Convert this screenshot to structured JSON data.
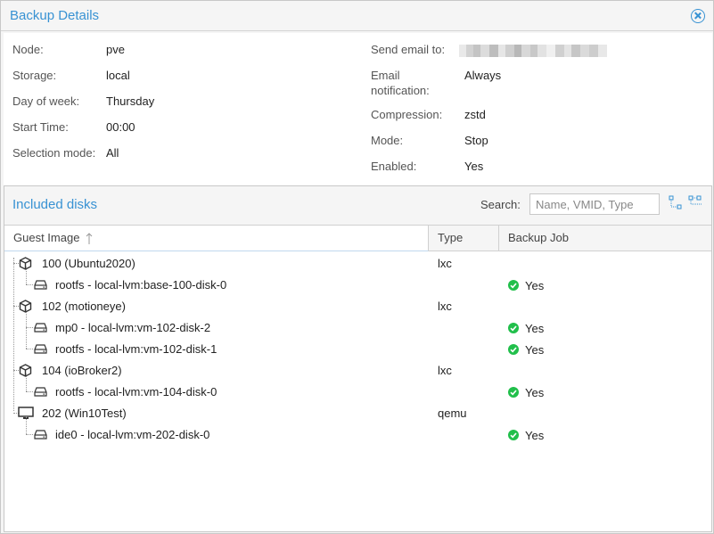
{
  "window": {
    "title": "Backup Details"
  },
  "details": {
    "left": [
      {
        "label": "Node:",
        "value": "pve"
      },
      {
        "label": "Storage:",
        "value": "local"
      },
      {
        "label": "Day of week:",
        "value": "Thursday"
      },
      {
        "label": "Start Time:",
        "value": "00:00"
      },
      {
        "label": "Selection mode:",
        "value": "All"
      }
    ],
    "right": [
      {
        "label": "Send email to:",
        "value": ""
      },
      {
        "label": "Email notification:",
        "value": "Always"
      },
      {
        "label": "Compression:",
        "value": "zstd"
      },
      {
        "label": "Mode:",
        "value": "Stop"
      },
      {
        "label": "Enabled:",
        "value": "Yes"
      }
    ],
    "email_label_line1": "Email",
    "email_label_line2": "notification:"
  },
  "disks": {
    "title": "Included disks",
    "search_label": "Search:",
    "search_placeholder": "Name, VMID, Type",
    "columns": {
      "guest": "Guest Image",
      "type": "Type",
      "job": "Backup Job"
    },
    "rows": [
      {
        "kind": "guest",
        "icon": "container-icon",
        "name": "100 (Ubuntu2020)",
        "type": "lxc",
        "job": ""
      },
      {
        "kind": "disk",
        "icon": "hdd-icon",
        "name": "rootfs - local-lvm:base-100-disk-0",
        "type": "",
        "job": "Yes"
      },
      {
        "kind": "guest",
        "icon": "container-icon",
        "name": "102 (motioneye)",
        "type": "lxc",
        "job": ""
      },
      {
        "kind": "disk",
        "icon": "hdd-icon",
        "name": "mp0 - local-lvm:vm-102-disk-2",
        "type": "",
        "job": "Yes"
      },
      {
        "kind": "disk",
        "icon": "hdd-icon",
        "name": "rootfs - local-lvm:vm-102-disk-1",
        "type": "",
        "job": "Yes"
      },
      {
        "kind": "guest",
        "icon": "container-icon",
        "name": "104 (ioBroker2)",
        "type": "lxc",
        "job": ""
      },
      {
        "kind": "disk",
        "icon": "hdd-icon",
        "name": "rootfs - local-lvm:vm-104-disk-0",
        "type": "",
        "job": "Yes"
      },
      {
        "kind": "guest",
        "icon": "monitor-icon",
        "name": "202 (Win10Test)",
        "type": "qemu",
        "job": ""
      },
      {
        "kind": "disk",
        "icon": "hdd-icon",
        "name": "ide0 - local-lvm:vm-202-disk-0",
        "type": "",
        "job": "Yes"
      }
    ]
  },
  "colors": {
    "accent": "#3892d3",
    "check": "#21bf4b"
  }
}
